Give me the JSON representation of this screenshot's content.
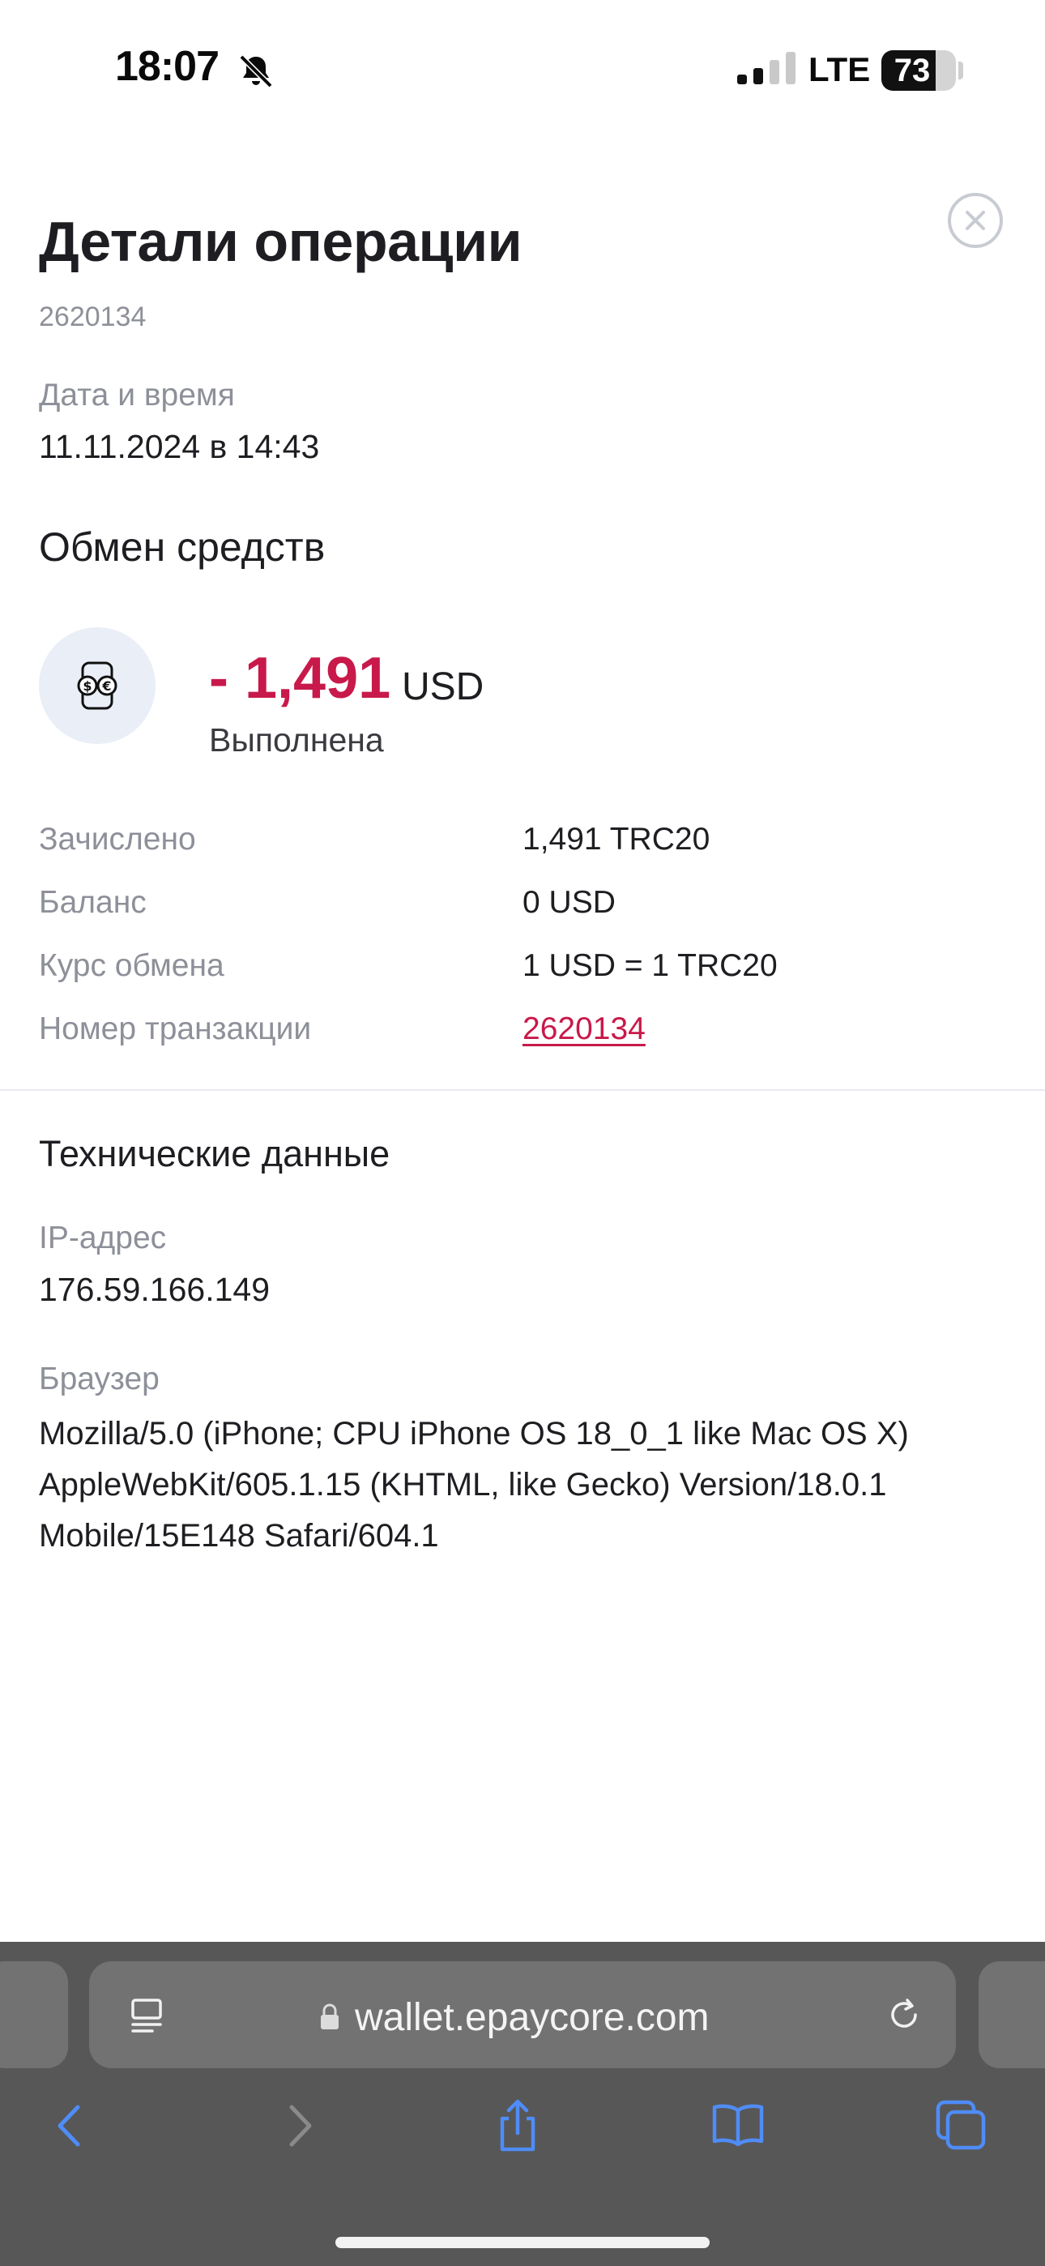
{
  "status_bar": {
    "time": "18:07",
    "network": "LTE",
    "battery": "73"
  },
  "header": {
    "title": "Детали операции",
    "operation_id": "2620134"
  },
  "datetime": {
    "label": "Дата и время",
    "value": "11.11.2024 в 14:43"
  },
  "operation": {
    "section_title": "Обмен средств",
    "amount": "- 1,491",
    "currency": "USD",
    "status": "Выполнена"
  },
  "details": [
    {
      "label": "Зачислено",
      "value": "1,491 TRC20"
    },
    {
      "label": "Баланс",
      "value": "0 USD"
    },
    {
      "label": "Курс обмена",
      "value": "1 USD = 1 TRC20"
    },
    {
      "label": "Номер транзакции",
      "value": "2620134"
    }
  ],
  "technical": {
    "title": "Технические данные",
    "ip_label": "IP-адрес",
    "ip_value": "176.59.166.149",
    "browser_label": "Браузер",
    "browser_value": "Mozilla/5.0 (iPhone; CPU iPhone OS 18_0_1 like Mac OS X) AppleWebKit/605.1.15 (KHTML, like Gecko) Version/18.0.1 Mobile/15E148 Safari/604.1"
  },
  "browser": {
    "url": "wallet.epaycore.com"
  },
  "colors": {
    "accent": "#c8194a",
    "muted": "#8d9099",
    "text": "#1e1e22",
    "toolbar": "#575757"
  }
}
